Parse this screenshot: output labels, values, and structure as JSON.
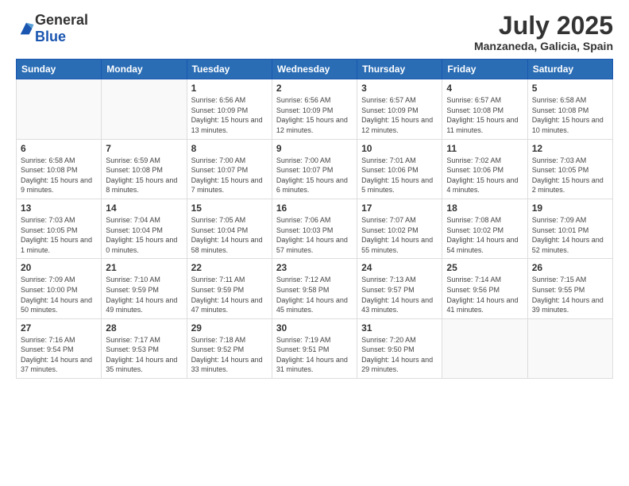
{
  "logo": {
    "general": "General",
    "blue": "Blue"
  },
  "header": {
    "month_year": "July 2025",
    "location": "Manzaneda, Galicia, Spain"
  },
  "weekdays": [
    "Sunday",
    "Monday",
    "Tuesday",
    "Wednesday",
    "Thursday",
    "Friday",
    "Saturday"
  ],
  "weeks": [
    [
      {
        "day": "",
        "info": ""
      },
      {
        "day": "",
        "info": ""
      },
      {
        "day": "1",
        "info": "Sunrise: 6:56 AM\nSunset: 10:09 PM\nDaylight: 15 hours and 13 minutes."
      },
      {
        "day": "2",
        "info": "Sunrise: 6:56 AM\nSunset: 10:09 PM\nDaylight: 15 hours and 12 minutes."
      },
      {
        "day": "3",
        "info": "Sunrise: 6:57 AM\nSunset: 10:09 PM\nDaylight: 15 hours and 12 minutes."
      },
      {
        "day": "4",
        "info": "Sunrise: 6:57 AM\nSunset: 10:08 PM\nDaylight: 15 hours and 11 minutes."
      },
      {
        "day": "5",
        "info": "Sunrise: 6:58 AM\nSunset: 10:08 PM\nDaylight: 15 hours and 10 minutes."
      }
    ],
    [
      {
        "day": "6",
        "info": "Sunrise: 6:58 AM\nSunset: 10:08 PM\nDaylight: 15 hours and 9 minutes."
      },
      {
        "day": "7",
        "info": "Sunrise: 6:59 AM\nSunset: 10:08 PM\nDaylight: 15 hours and 8 minutes."
      },
      {
        "day": "8",
        "info": "Sunrise: 7:00 AM\nSunset: 10:07 PM\nDaylight: 15 hours and 7 minutes."
      },
      {
        "day": "9",
        "info": "Sunrise: 7:00 AM\nSunset: 10:07 PM\nDaylight: 15 hours and 6 minutes."
      },
      {
        "day": "10",
        "info": "Sunrise: 7:01 AM\nSunset: 10:06 PM\nDaylight: 15 hours and 5 minutes."
      },
      {
        "day": "11",
        "info": "Sunrise: 7:02 AM\nSunset: 10:06 PM\nDaylight: 15 hours and 4 minutes."
      },
      {
        "day": "12",
        "info": "Sunrise: 7:03 AM\nSunset: 10:05 PM\nDaylight: 15 hours and 2 minutes."
      }
    ],
    [
      {
        "day": "13",
        "info": "Sunrise: 7:03 AM\nSunset: 10:05 PM\nDaylight: 15 hours and 1 minute."
      },
      {
        "day": "14",
        "info": "Sunrise: 7:04 AM\nSunset: 10:04 PM\nDaylight: 15 hours and 0 minutes."
      },
      {
        "day": "15",
        "info": "Sunrise: 7:05 AM\nSunset: 10:04 PM\nDaylight: 14 hours and 58 minutes."
      },
      {
        "day": "16",
        "info": "Sunrise: 7:06 AM\nSunset: 10:03 PM\nDaylight: 14 hours and 57 minutes."
      },
      {
        "day": "17",
        "info": "Sunrise: 7:07 AM\nSunset: 10:02 PM\nDaylight: 14 hours and 55 minutes."
      },
      {
        "day": "18",
        "info": "Sunrise: 7:08 AM\nSunset: 10:02 PM\nDaylight: 14 hours and 54 minutes."
      },
      {
        "day": "19",
        "info": "Sunrise: 7:09 AM\nSunset: 10:01 PM\nDaylight: 14 hours and 52 minutes."
      }
    ],
    [
      {
        "day": "20",
        "info": "Sunrise: 7:09 AM\nSunset: 10:00 PM\nDaylight: 14 hours and 50 minutes."
      },
      {
        "day": "21",
        "info": "Sunrise: 7:10 AM\nSunset: 9:59 PM\nDaylight: 14 hours and 49 minutes."
      },
      {
        "day": "22",
        "info": "Sunrise: 7:11 AM\nSunset: 9:59 PM\nDaylight: 14 hours and 47 minutes."
      },
      {
        "day": "23",
        "info": "Sunrise: 7:12 AM\nSunset: 9:58 PM\nDaylight: 14 hours and 45 minutes."
      },
      {
        "day": "24",
        "info": "Sunrise: 7:13 AM\nSunset: 9:57 PM\nDaylight: 14 hours and 43 minutes."
      },
      {
        "day": "25",
        "info": "Sunrise: 7:14 AM\nSunset: 9:56 PM\nDaylight: 14 hours and 41 minutes."
      },
      {
        "day": "26",
        "info": "Sunrise: 7:15 AM\nSunset: 9:55 PM\nDaylight: 14 hours and 39 minutes."
      }
    ],
    [
      {
        "day": "27",
        "info": "Sunrise: 7:16 AM\nSunset: 9:54 PM\nDaylight: 14 hours and 37 minutes."
      },
      {
        "day": "28",
        "info": "Sunrise: 7:17 AM\nSunset: 9:53 PM\nDaylight: 14 hours and 35 minutes."
      },
      {
        "day": "29",
        "info": "Sunrise: 7:18 AM\nSunset: 9:52 PM\nDaylight: 14 hours and 33 minutes."
      },
      {
        "day": "30",
        "info": "Sunrise: 7:19 AM\nSunset: 9:51 PM\nDaylight: 14 hours and 31 minutes."
      },
      {
        "day": "31",
        "info": "Sunrise: 7:20 AM\nSunset: 9:50 PM\nDaylight: 14 hours and 29 minutes."
      },
      {
        "day": "",
        "info": ""
      },
      {
        "day": "",
        "info": ""
      }
    ]
  ]
}
